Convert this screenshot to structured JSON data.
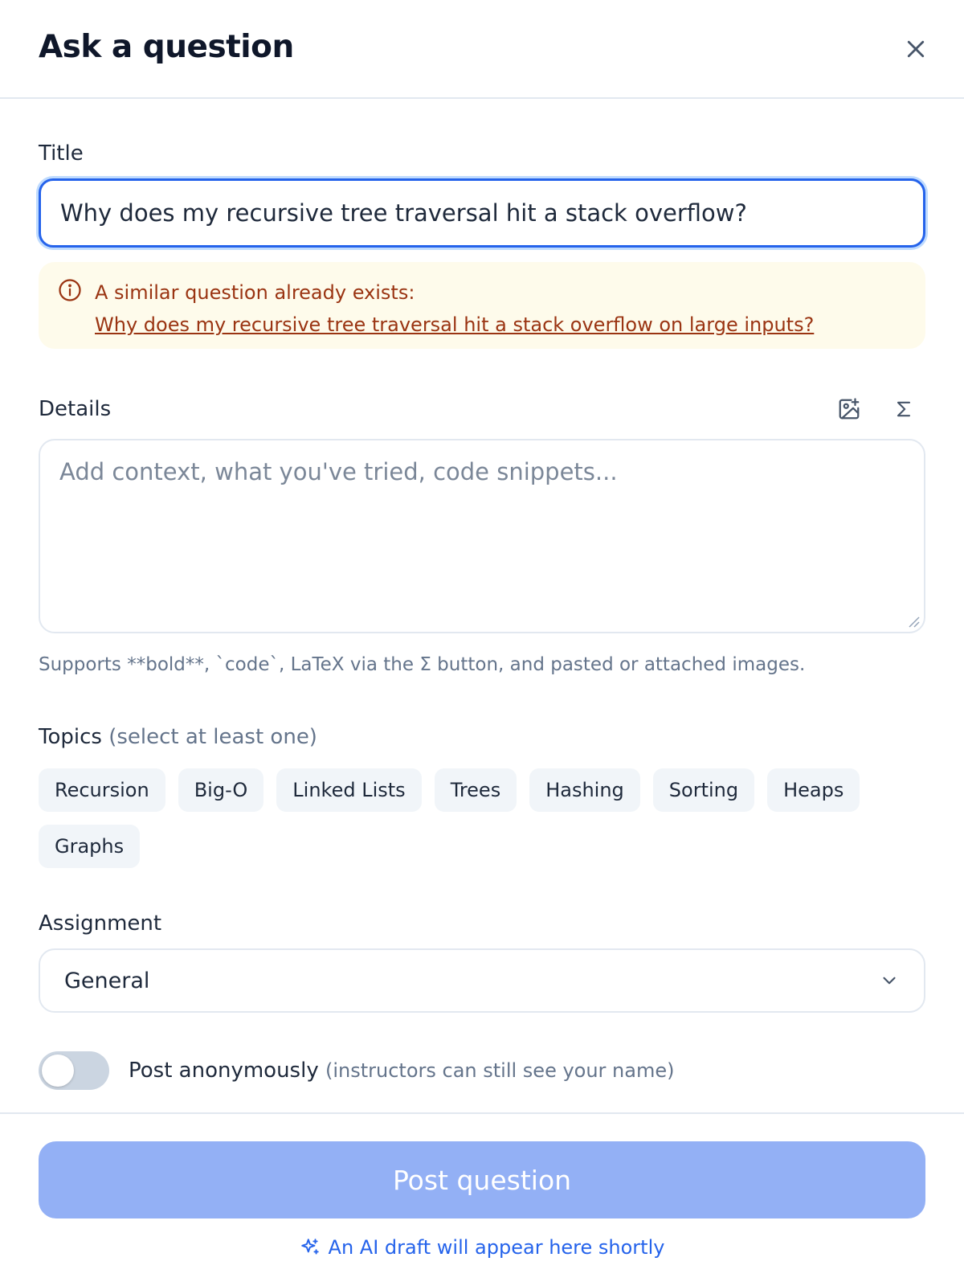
{
  "header": {
    "title": "Ask a question",
    "close_icon": "close-icon"
  },
  "title_field": {
    "label": "Title",
    "value": "Why does my recursive tree traversal hit a stack overflow?"
  },
  "similar_warning": {
    "icon": "info-icon",
    "message": "A similar question already exists:",
    "link_text": "Why does my recursive tree traversal hit a stack overflow on large inputs?",
    "color": "#9a3412",
    "background": "#fefbeb"
  },
  "details": {
    "label": "Details",
    "placeholder": "Add context, what you've tried, code snippets...",
    "tools": [
      "image-add-icon",
      "sigma-icon"
    ],
    "hint": "Supports **bold**, `code`, LaTeX via the Σ button, and pasted or attached images."
  },
  "topics": {
    "label": "Topics",
    "label_note": "(select at least one)",
    "items": [
      "Recursion",
      "Big-O",
      "Linked Lists",
      "Trees",
      "Hashing",
      "Sorting",
      "Heaps",
      "Graphs"
    ]
  },
  "assignment": {
    "label": "Assignment",
    "selected": "General"
  },
  "anonymous": {
    "label": "Post anonymously",
    "note": "(instructors can still see your name)",
    "enabled": false
  },
  "footer": {
    "post_label": "Post question",
    "post_color": "#93b0f5",
    "ai_note": "An AI draft will appear here shortly",
    "accent": "#2563eb"
  }
}
